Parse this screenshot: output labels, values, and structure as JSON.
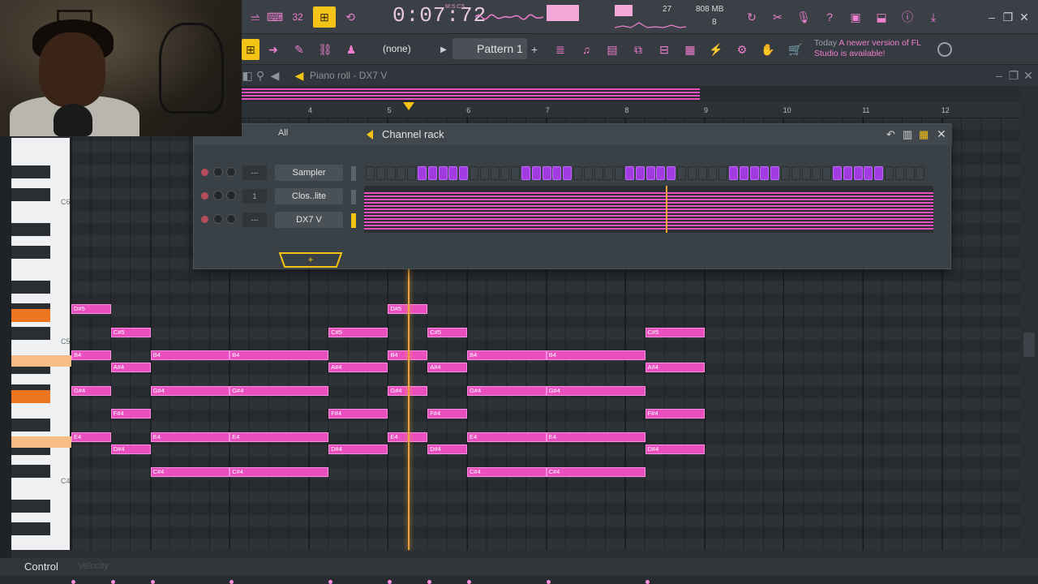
{
  "app": {
    "time": "0:07:72",
    "time_unit": "M:S:CS",
    "pattern": "Pattern 1",
    "snap": "(none)",
    "memory": "808 MB",
    "poly": "27",
    "voices": "8",
    "news_today": "Today",
    "news_text": "A newer version of FL Studio is available!",
    "accent": "#e94fbe",
    "highlight": "#f3c316"
  },
  "piano_roll": {
    "title": "Piano roll - DX7 V",
    "ruler": [
      "4",
      "5",
      "6",
      "7",
      "8",
      "9",
      "10",
      "11",
      "12"
    ],
    "octave_labels": [
      "C6",
      "C5",
      "C4"
    ],
    "notes": [
      {
        "label": "D#5",
        "row": 8,
        "start": 0,
        "len": 2
      },
      {
        "label": "D#5",
        "row": 8,
        "start": 16,
        "len": 2
      },
      {
        "label": "C#5",
        "row": 10,
        "start": 2,
        "len": 2
      },
      {
        "label": "C#5",
        "row": 10,
        "start": 13,
        "len": 3
      },
      {
        "label": "C#5",
        "row": 10,
        "start": 18,
        "len": 2
      },
      {
        "label": "C#5",
        "row": 10,
        "start": 29,
        "len": 3
      },
      {
        "label": "B4",
        "row": 12,
        "start": 0,
        "len": 2
      },
      {
        "label": "B4",
        "row": 12,
        "start": 4,
        "len": 4
      },
      {
        "label": "B4",
        "row": 12,
        "start": 8,
        "len": 5
      },
      {
        "label": "B4",
        "row": 12,
        "start": 16,
        "len": 2
      },
      {
        "label": "B4",
        "row": 12,
        "start": 20,
        "len": 4
      },
      {
        "label": "B4",
        "row": 12,
        "start": 24,
        "len": 5
      },
      {
        "label": "A#4",
        "row": 13,
        "start": 2,
        "len": 2
      },
      {
        "label": "A#4",
        "row": 13,
        "start": 13,
        "len": 3
      },
      {
        "label": "A#4",
        "row": 13,
        "start": 18,
        "len": 2
      },
      {
        "label": "A#4",
        "row": 13,
        "start": 29,
        "len": 3
      },
      {
        "label": "G#4",
        "row": 15,
        "start": 0,
        "len": 2
      },
      {
        "label": "G#4",
        "row": 15,
        "start": 4,
        "len": 4
      },
      {
        "label": "G#4",
        "row": 15,
        "start": 8,
        "len": 5
      },
      {
        "label": "G#4",
        "row": 15,
        "start": 16,
        "len": 2
      },
      {
        "label": "G#4",
        "row": 15,
        "start": 20,
        "len": 4
      },
      {
        "label": "G#4",
        "row": 15,
        "start": 24,
        "len": 5
      },
      {
        "label": "F#4",
        "row": 17,
        "start": 2,
        "len": 2
      },
      {
        "label": "F#4",
        "row": 17,
        "start": 13,
        "len": 3
      },
      {
        "label": "F#4",
        "row": 17,
        "start": 18,
        "len": 2
      },
      {
        "label": "F#4",
        "row": 17,
        "start": 29,
        "len": 3
      },
      {
        "label": "E4",
        "row": 19,
        "start": 0,
        "len": 2
      },
      {
        "label": "E4",
        "row": 19,
        "start": 4,
        "len": 4
      },
      {
        "label": "E4",
        "row": 19,
        "start": 8,
        "len": 5
      },
      {
        "label": "E4",
        "row": 19,
        "start": 16,
        "len": 2
      },
      {
        "label": "E4",
        "row": 19,
        "start": 20,
        "len": 4
      },
      {
        "label": "E4",
        "row": 19,
        "start": 24,
        "len": 5
      },
      {
        "label": "D#4",
        "row": 20,
        "start": 2,
        "len": 2
      },
      {
        "label": "D#4",
        "row": 20,
        "start": 13,
        "len": 3
      },
      {
        "label": "D#4",
        "row": 20,
        "start": 18,
        "len": 2
      },
      {
        "label": "D#4",
        "row": 20,
        "start": 29,
        "len": 3
      },
      {
        "label": "C#4",
        "row": 22,
        "start": 4,
        "len": 4
      },
      {
        "label": "C#4",
        "row": 22,
        "start": 8,
        "len": 5
      },
      {
        "label": "C#4",
        "row": 22,
        "start": 20,
        "len": 4
      },
      {
        "label": "C#4",
        "row": 22,
        "start": 24,
        "len": 5
      }
    ]
  },
  "channel_rack": {
    "filter": "All",
    "title": "Channel rack",
    "channels": [
      {
        "name": "Sampler",
        "target": "---"
      },
      {
        "name": "Clos..lite",
        "target": "1"
      },
      {
        "name": "DX7 V",
        "target": "---"
      }
    ],
    "steps_on": [
      5,
      6,
      7,
      8,
      9,
      15,
      16,
      17,
      18,
      19,
      25,
      26,
      27,
      28,
      29,
      35,
      36,
      37,
      38,
      39,
      45,
      46,
      47,
      48,
      49
    ]
  },
  "control": {
    "label": "Control",
    "sub": "Velocity"
  }
}
